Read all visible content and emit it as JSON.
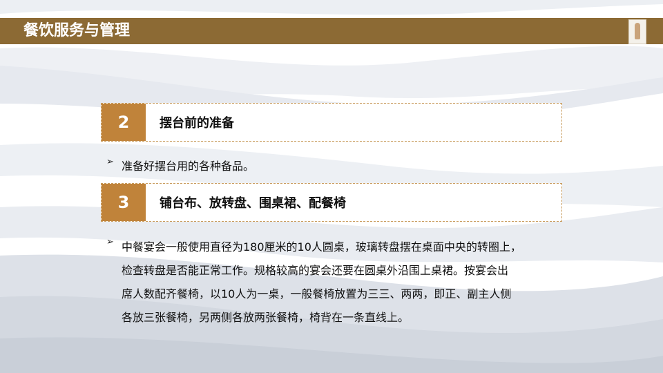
{
  "header": {
    "title": "餐饮服务与管理",
    "thumbnail_icon": "figure-thumbnail-icon"
  },
  "sections": [
    {
      "number": "2",
      "title": "摆台前的准备"
    },
    {
      "number": "3",
      "title": "铺台布、放转盘、围桌裙、配餐椅"
    }
  ],
  "bullets": [
    {
      "arrow": "➢",
      "text": "准备好摆台用的各种备品。"
    },
    {
      "arrow": "➢"
    }
  ],
  "paragraph_lines": [
    "中餐宴会一般使用直径为180厘米的10人圆桌，玻璃转盘摆在桌面中央的转圈上，",
    "检查转盘是否能正常工作。规格较高的宴会还要在圆桌外沿围上桌裙。按宴会出",
    "席人数配齐餐椅，以10人为一桌，一般餐椅放置为三三、两两，即正、副主人侧",
    "各放三张餐椅，另两侧各放两张餐椅，椅背在一条直线上。"
  ],
  "colors": {
    "header_bar": "#8c6a34",
    "number_box": "#c0833a",
    "dashed_border": "#c89a5a",
    "background_waves": "#dfe3ea"
  }
}
